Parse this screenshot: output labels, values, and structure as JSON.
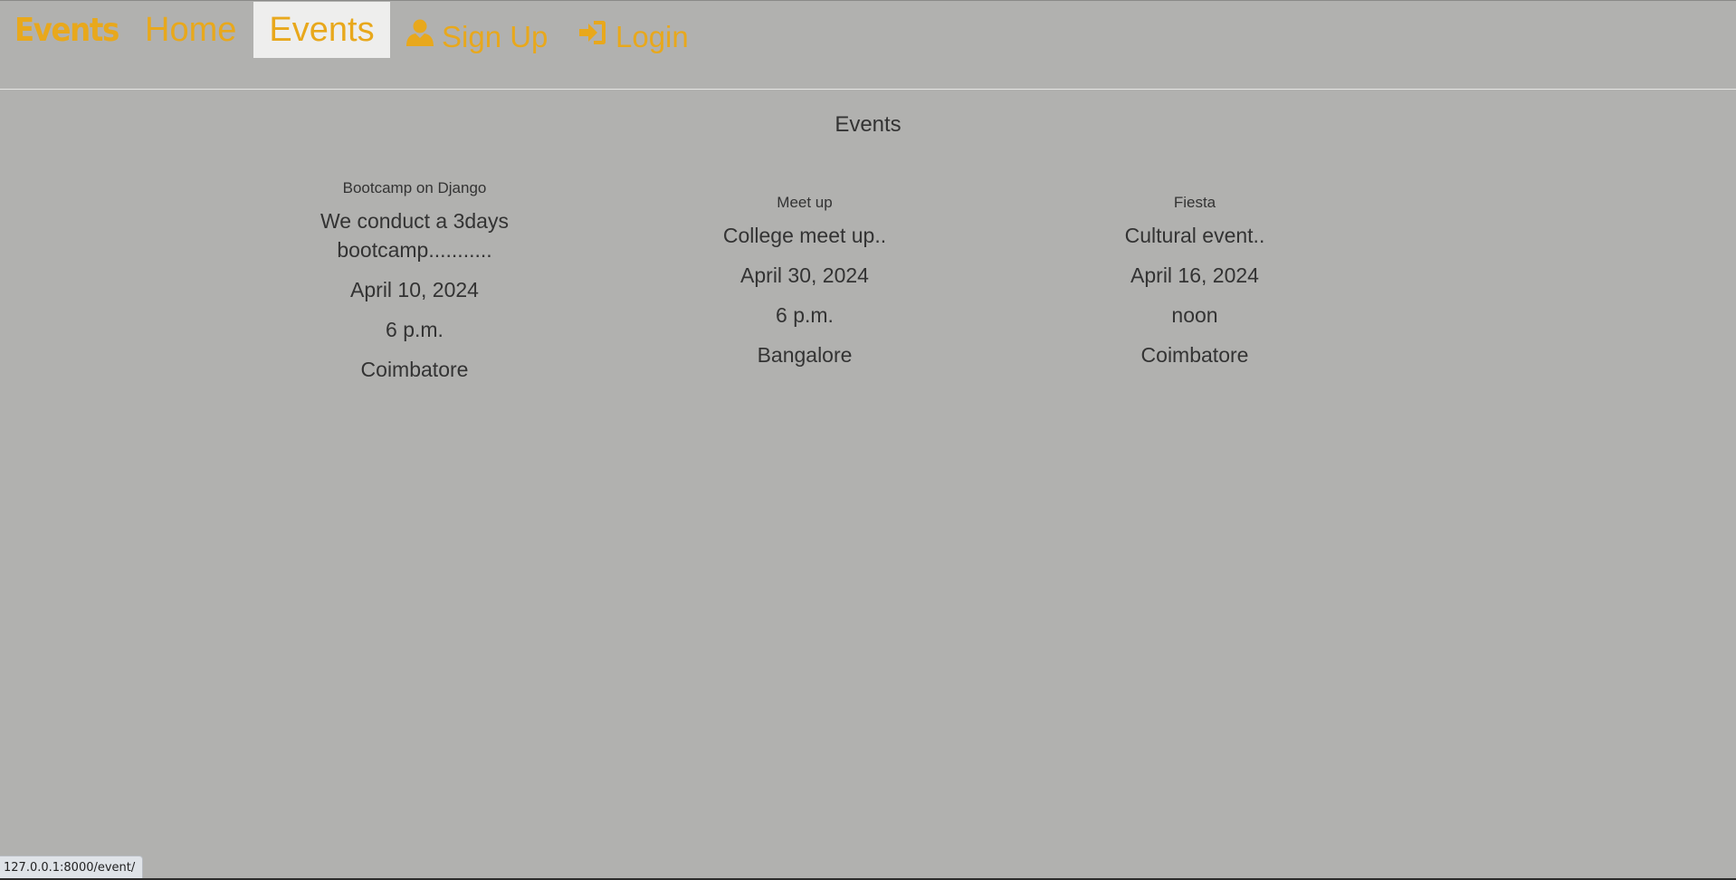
{
  "navbar": {
    "brand": "Events",
    "items": [
      {
        "label": "Home"
      },
      {
        "label": "Events"
      },
      {
        "label": "Sign Up",
        "icon": "user-icon"
      },
      {
        "label": "Login",
        "icon": "login-icon"
      }
    ],
    "accent_color": "#e8a81c",
    "active_item": "Events"
  },
  "main": {
    "title": "Events",
    "events": [
      {
        "name": "Bootcamp on Django",
        "description": "We conduct a 3days bootcamp...........",
        "date": "April 10, 2024",
        "time": "6 p.m.",
        "location": "Coimbatore"
      },
      {
        "name": "Meet up",
        "description": "College meet up..",
        "date": "April 30, 2024",
        "time": "6 p.m.",
        "location": "Bangalore"
      },
      {
        "name": "Fiesta",
        "description": "Cultural event..",
        "date": "April 16, 2024",
        "time": "noon",
        "location": "Coimbatore"
      }
    ]
  },
  "status_bar": {
    "url": "127.0.0.1:8000/event/"
  }
}
